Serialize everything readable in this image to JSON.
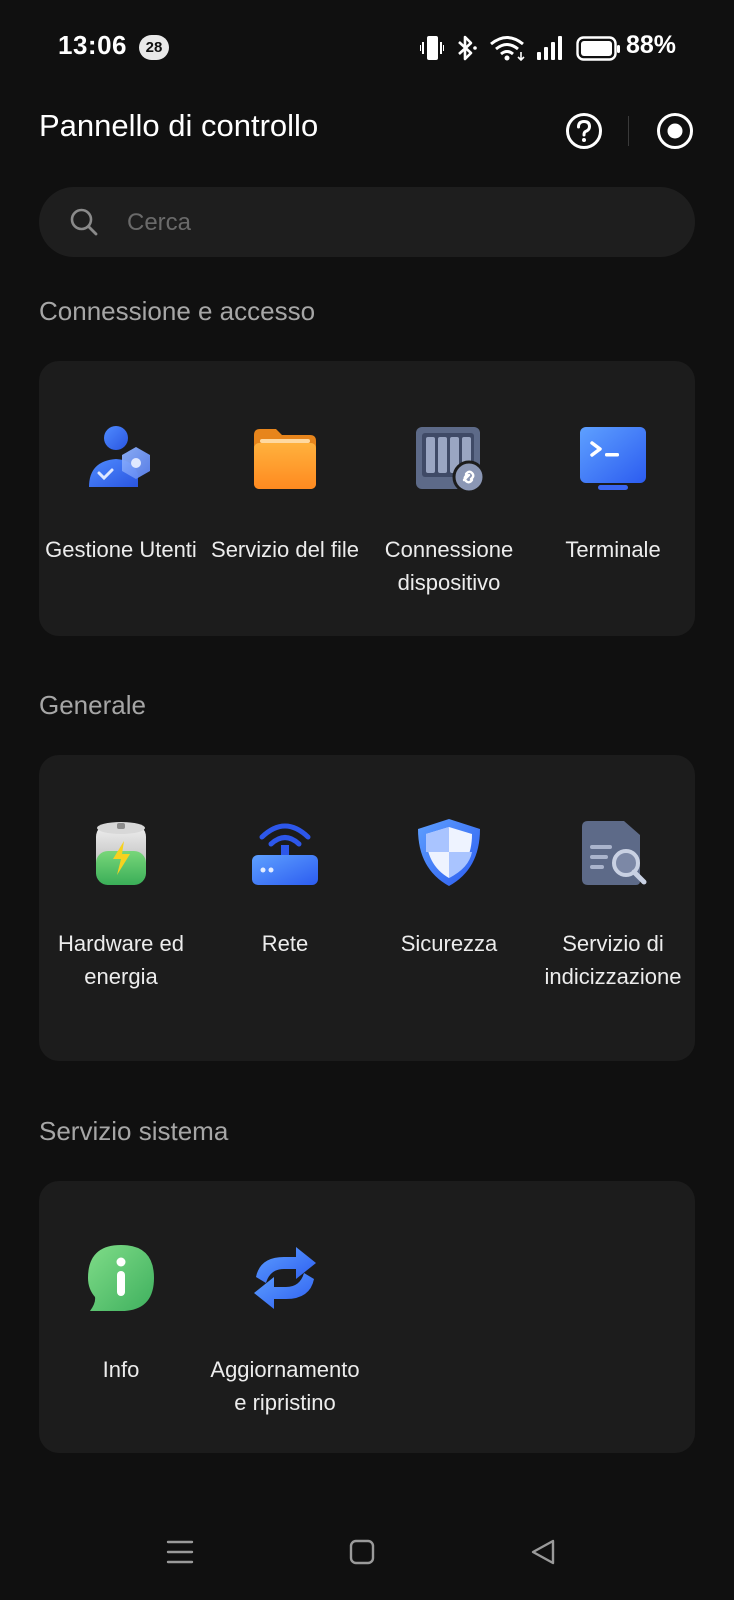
{
  "status_bar": {
    "time": "13:06",
    "notification_count": "28",
    "battery_percent": "88%",
    "icons": [
      "vibrate-icon",
      "bluetooth-icon",
      "wifi-icon",
      "signal-icon",
      "battery-icon"
    ]
  },
  "header": {
    "title": "Pannello di controllo",
    "help_icon": "help-icon",
    "more_icon": "target-icon"
  },
  "search": {
    "placeholder": "Cerca",
    "value": ""
  },
  "sections": [
    {
      "title": "Connessione e accesso",
      "items": [
        {
          "label": "Gestione Utenti",
          "icon": "users-icon"
        },
        {
          "label": "Servizio del file",
          "icon": "folder-icon"
        },
        {
          "label": "Connessione dispositivo",
          "icon": "device-link-icon"
        },
        {
          "label": "Terminale",
          "icon": "terminal-icon"
        }
      ]
    },
    {
      "title": "Generale",
      "items": [
        {
          "label": "Hardware ed energia",
          "icon": "battery-energy-icon"
        },
        {
          "label": "Rete",
          "icon": "router-icon"
        },
        {
          "label": "Sicurezza",
          "icon": "shield-icon"
        },
        {
          "label": "Servizio di indicizzazione",
          "icon": "index-search-icon"
        }
      ]
    },
    {
      "title": "Servizio sistema",
      "items": [
        {
          "label": "Info",
          "icon": "info-icon"
        },
        {
          "label": "Aggiornamento e ripristino",
          "icon": "update-icon"
        }
      ]
    }
  ],
  "nav_bar": {
    "buttons": [
      "menu-icon",
      "home-icon",
      "back-icon"
    ]
  },
  "colors": {
    "background": "#101010",
    "card": "#1c1c1c",
    "section_title": "#a6a6a6",
    "accent_blue": "#3b6cf6",
    "accent_orange": "#ff9a2e",
    "accent_green": "#5cc97a"
  }
}
